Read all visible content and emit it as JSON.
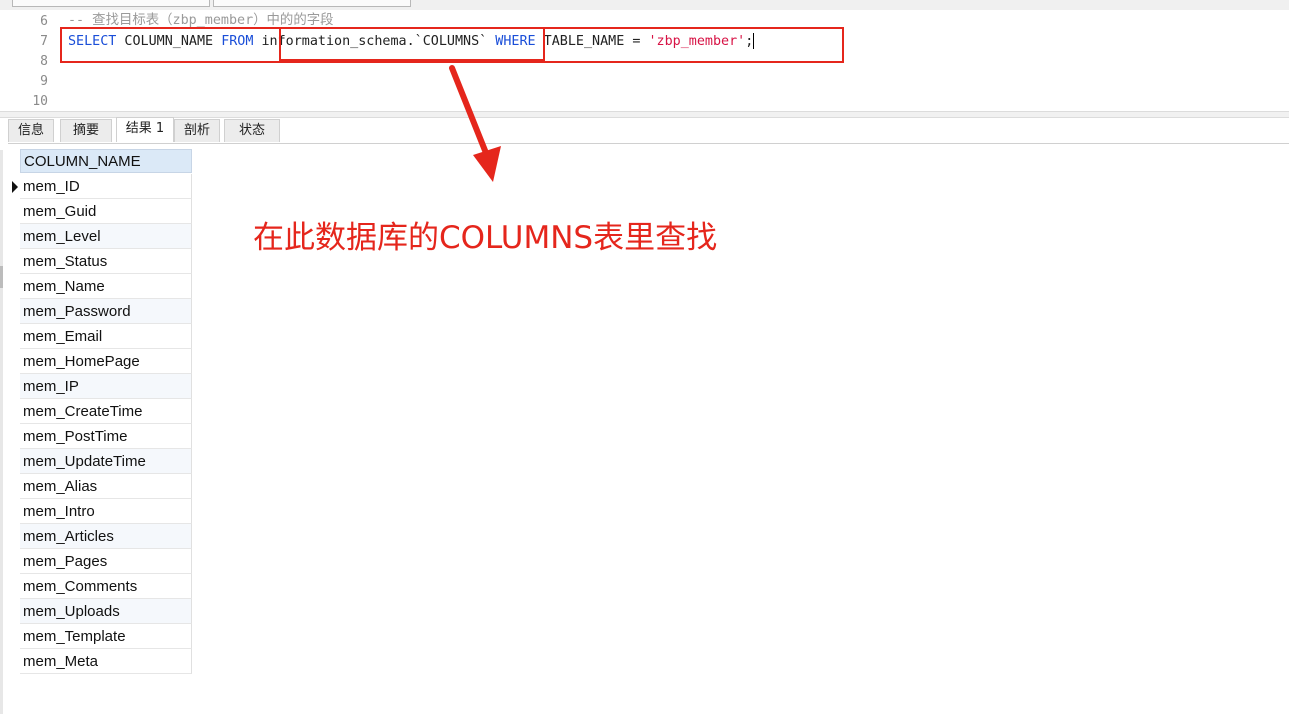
{
  "editor": {
    "lines": [
      {
        "num": "6",
        "text": "-- 查找目标表（zbp_member）中的的字段"
      },
      {
        "num": "7"
      },
      {
        "num": "8"
      },
      {
        "num": "9"
      },
      {
        "num": "10"
      }
    ],
    "sql": {
      "select_kw": "SELECT",
      "column": " COLUMN_NAME ",
      "from_kw": "FROM",
      "table": "information_schema.`COLUMNS`",
      "where_kw": "WHERE",
      "condition": " TABLE_NAME = ",
      "value": "'zbp_member'",
      "terminator": ";"
    }
  },
  "tabs": [
    {
      "label": "信息",
      "active": false
    },
    {
      "label": "摘要",
      "active": false
    },
    {
      "label": "结果 1",
      "active": true
    },
    {
      "label": "剖析",
      "active": false
    },
    {
      "label": "状态",
      "active": false
    }
  ],
  "result": {
    "header": "COLUMN_NAME",
    "rows": [
      "mem_ID",
      "mem_Guid",
      "mem_Level",
      "mem_Status",
      "mem_Name",
      "mem_Password",
      "mem_Email",
      "mem_HomePage",
      "mem_IP",
      "mem_CreateTime",
      "mem_PostTime",
      "mem_UpdateTime",
      "mem_Alias",
      "mem_Intro",
      "mem_Articles",
      "mem_Pages",
      "mem_Comments",
      "mem_Uploads",
      "mem_Template",
      "mem_Meta"
    ]
  },
  "annotation": {
    "text": "在此数据库的COLUMNS表里查找",
    "color": "#e5261c"
  }
}
